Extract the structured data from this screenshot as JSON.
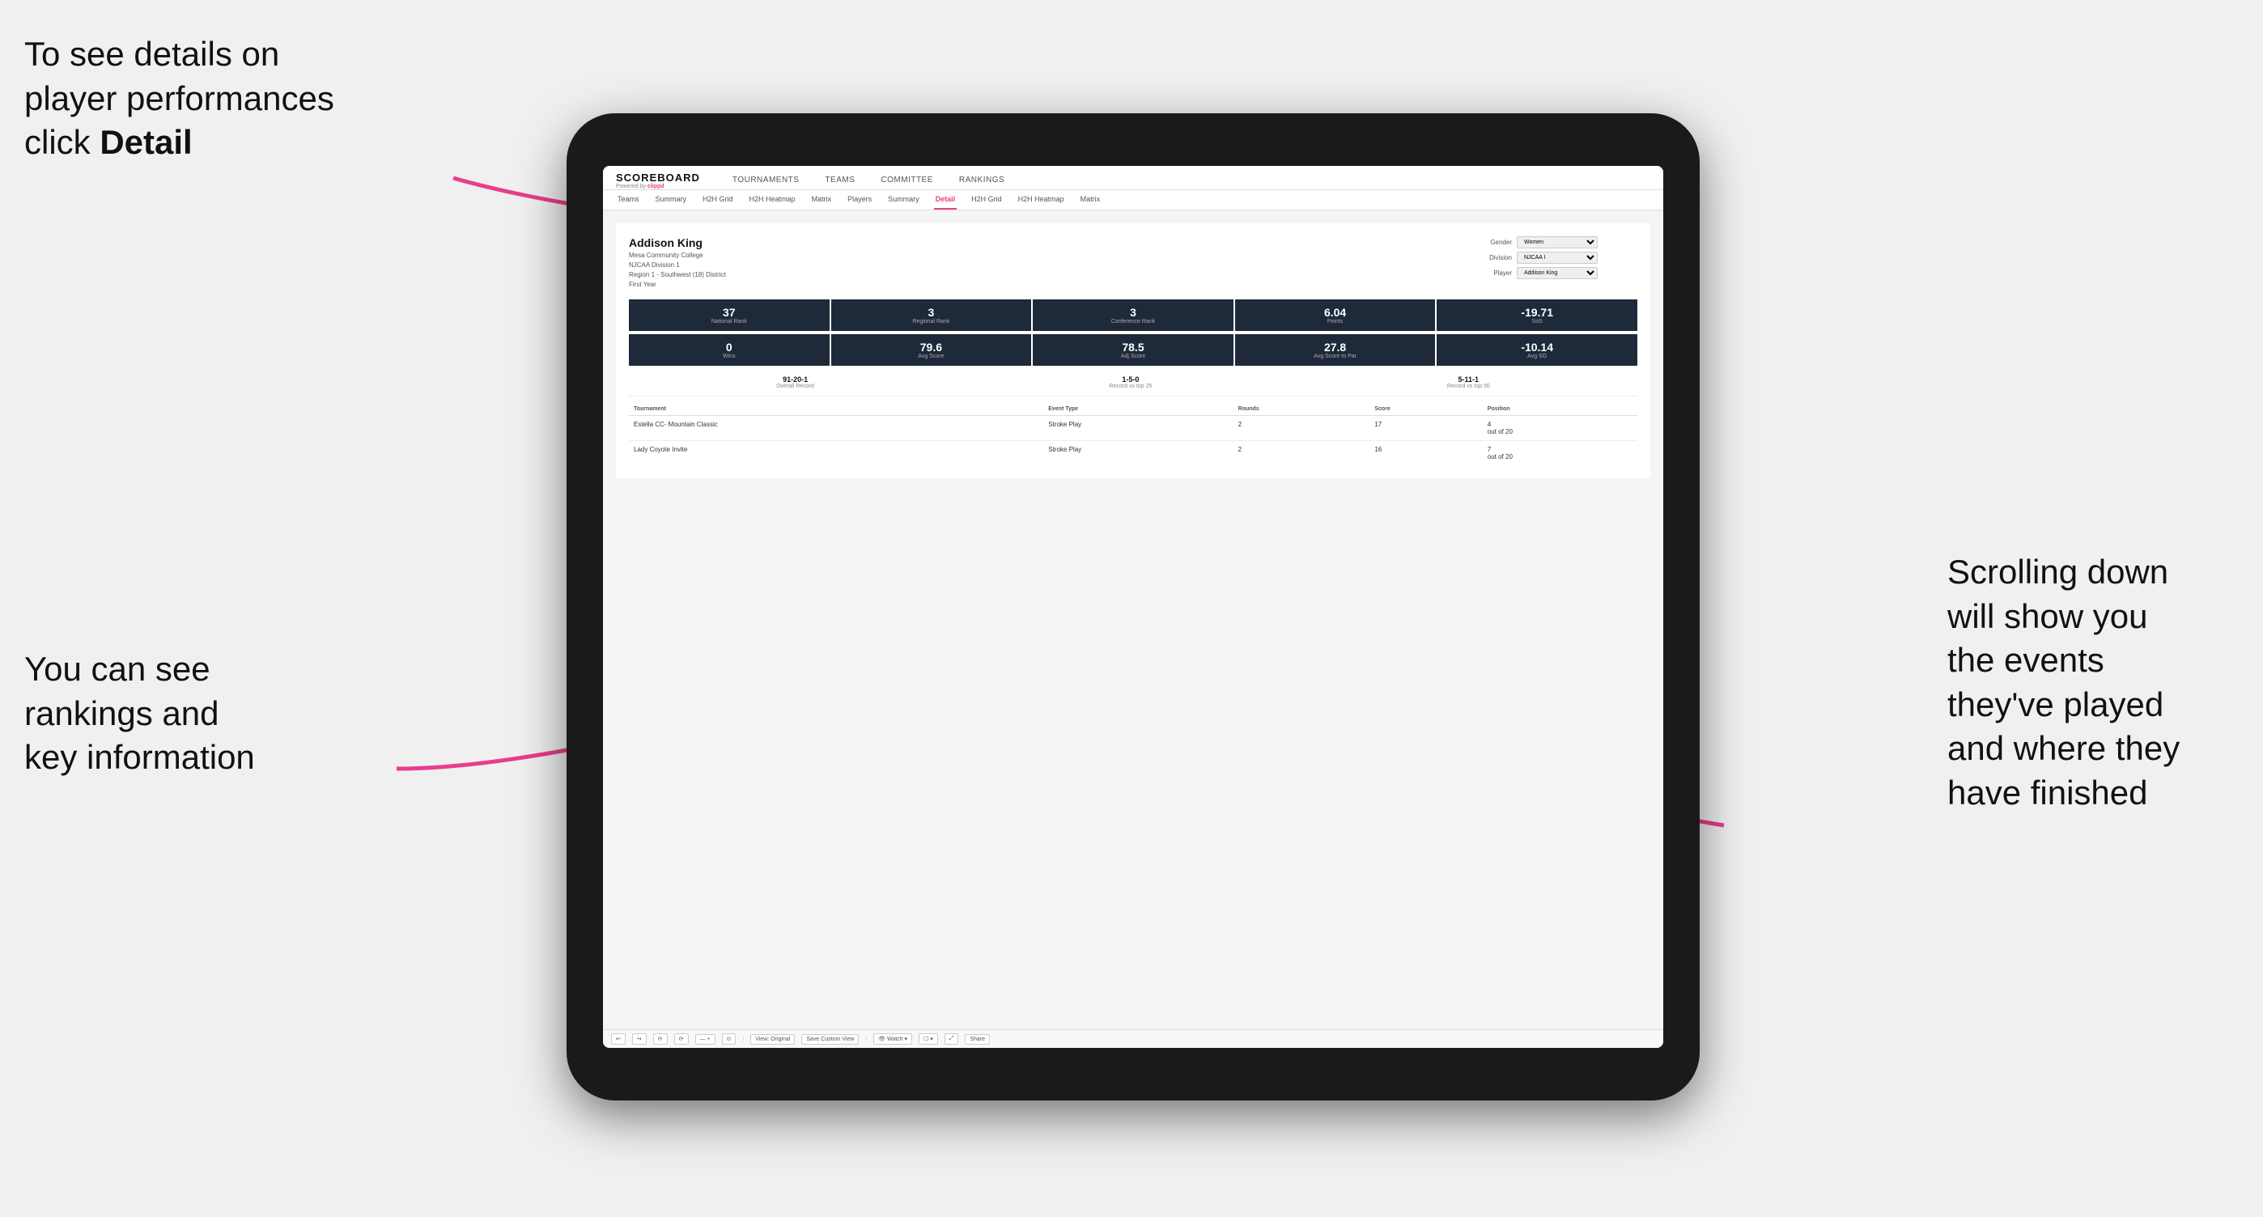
{
  "annotations": {
    "top_left_line1": "To see details on",
    "top_left_line2": "player performances",
    "top_left_line3": "click ",
    "top_left_bold": "Detail",
    "bottom_left_line1": "You can see",
    "bottom_left_line2": "rankings and",
    "bottom_left_line3": "key information",
    "bottom_right_line1": "Scrolling down",
    "bottom_right_line2": "will show you",
    "bottom_right_line3": "the events",
    "bottom_right_line4": "they've played",
    "bottom_right_line5": "and where they",
    "bottom_right_line6": "have finished"
  },
  "nav": {
    "logo": "SCOREBOARD",
    "powered_by": "Powered by clippd",
    "items": [
      "TOURNAMENTS",
      "TEAMS",
      "COMMITTEE",
      "RANKINGS"
    ]
  },
  "sub_nav": {
    "items": [
      "Teams",
      "Summary",
      "H2H Grid",
      "H2H Heatmap",
      "Matrix",
      "Players",
      "Summary",
      "Detail",
      "H2H Grid",
      "H2H Heatmap",
      "Matrix"
    ],
    "active": "Detail"
  },
  "player": {
    "name": "Addison King",
    "school": "Mesa Community College",
    "division": "NJCAA Division 1",
    "region": "Region 1 - Southwest (18) District",
    "year": "First Year",
    "gender_label": "Gender",
    "gender_value": "Women",
    "division_label": "Division",
    "division_value": "NJCAA I",
    "player_label": "Player",
    "player_value": "Addison King"
  },
  "stats_row1": [
    {
      "value": "37",
      "label": "National Rank"
    },
    {
      "value": "3",
      "label": "Regional Rank"
    },
    {
      "value": "3",
      "label": "Conference Rank"
    },
    {
      "value": "6.04",
      "label": "Points"
    },
    {
      "value": "-19.71",
      "label": "SoS"
    }
  ],
  "stats_row2": [
    {
      "value": "0",
      "label": "Wins"
    },
    {
      "value": "79.6",
      "label": "Avg Score"
    },
    {
      "value": "78.5",
      "label": "Adj Score"
    },
    {
      "value": "27.8",
      "label": "Avg Score to Par"
    },
    {
      "value": "-10.14",
      "label": "Avg SG"
    }
  ],
  "records": [
    {
      "value": "91-20-1",
      "label": "Overall Record"
    },
    {
      "value": "1-5-0",
      "label": "Record vs top 25"
    },
    {
      "value": "5-11-1",
      "label": "Record vs top 50"
    }
  ],
  "table": {
    "headers": [
      "Tournament",
      "Event Type",
      "Rounds",
      "Score",
      "Position"
    ],
    "rows": [
      {
        "tournament": "Estella CC- Mountain Classic",
        "event_type": "Stroke Play",
        "rounds": "2",
        "score": "17",
        "position": "4\nout of 20"
      },
      {
        "tournament": "Lady Coyote Invite",
        "event_type": "Stroke Play",
        "rounds": "2",
        "score": "16",
        "position": "7\nout of 20"
      }
    ]
  },
  "toolbar": {
    "items": [
      "↩",
      "↪",
      "⟳",
      "⟳",
      "— +",
      "⊙",
      "View: Original",
      "Save Custom View",
      "👁 Watch ▾",
      "☐ ▾",
      "⤢",
      "Share"
    ]
  }
}
